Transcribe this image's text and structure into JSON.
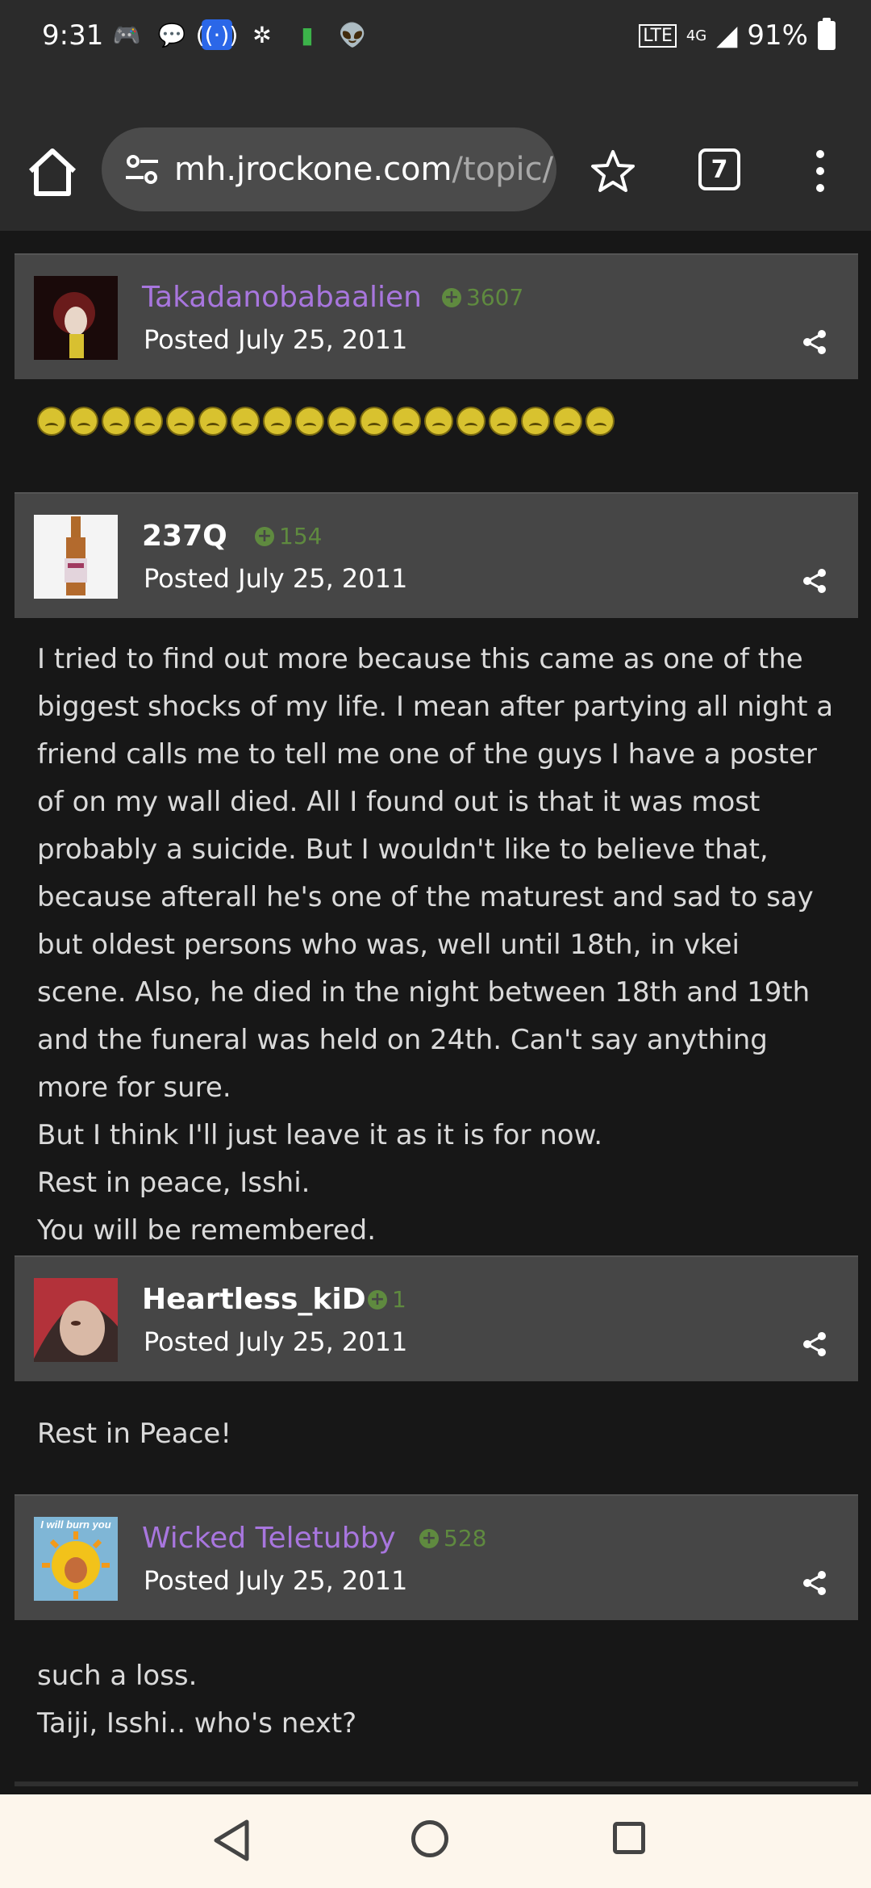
{
  "status_bar": {
    "time": "9:31",
    "network": "4G",
    "battery": "91%"
  },
  "browser": {
    "url_domain": "mh.jrockone.com",
    "url_path": "/topic/",
    "tab_count": "7"
  },
  "posts": [
    {
      "author": "Takadanobabaalien",
      "author_color": "#a876de",
      "reputation": "3607",
      "posted": "Posted July 25, 2011",
      "emoji_count": 18,
      "body": []
    },
    {
      "author": "237Q",
      "author_color": "#ffffff",
      "reputation": "154",
      "posted": "Posted July 25, 2011",
      "body": [
        "I tried to find out more because this came as one of the biggest shocks of my life. I mean after partying all night a friend calls me to tell me one of the guys I have a poster of on my wall died. All I found out is that it was most probably a suicide. But I wouldn't like to believe that, because afterall he's one of the maturest and sad to say but oldest persons who was, well until 18th, in vkei scene. Also, he died in the night between 18th and 19th and the funeral was held on 24th. Can't say anything more for sure.",
        "But I think I'll just leave it as it is for now.",
        "Rest in peace, Isshi.",
        "You will be remembered."
      ]
    },
    {
      "author": "Heartless_kiD",
      "author_color": "#ffffff",
      "reputation": "1",
      "posted": "Posted July 25, 2011",
      "body": [
        "Rest in Peace!"
      ]
    },
    {
      "author": "Wicked Teletubby",
      "author_color": "#a876de",
      "reputation": "528",
      "posted": "Posted July 25, 2011",
      "avatar_caption": "I will burn you",
      "body": [
        "such a loss.",
        "Taiji, Isshi.. who's next?"
      ]
    }
  ]
}
